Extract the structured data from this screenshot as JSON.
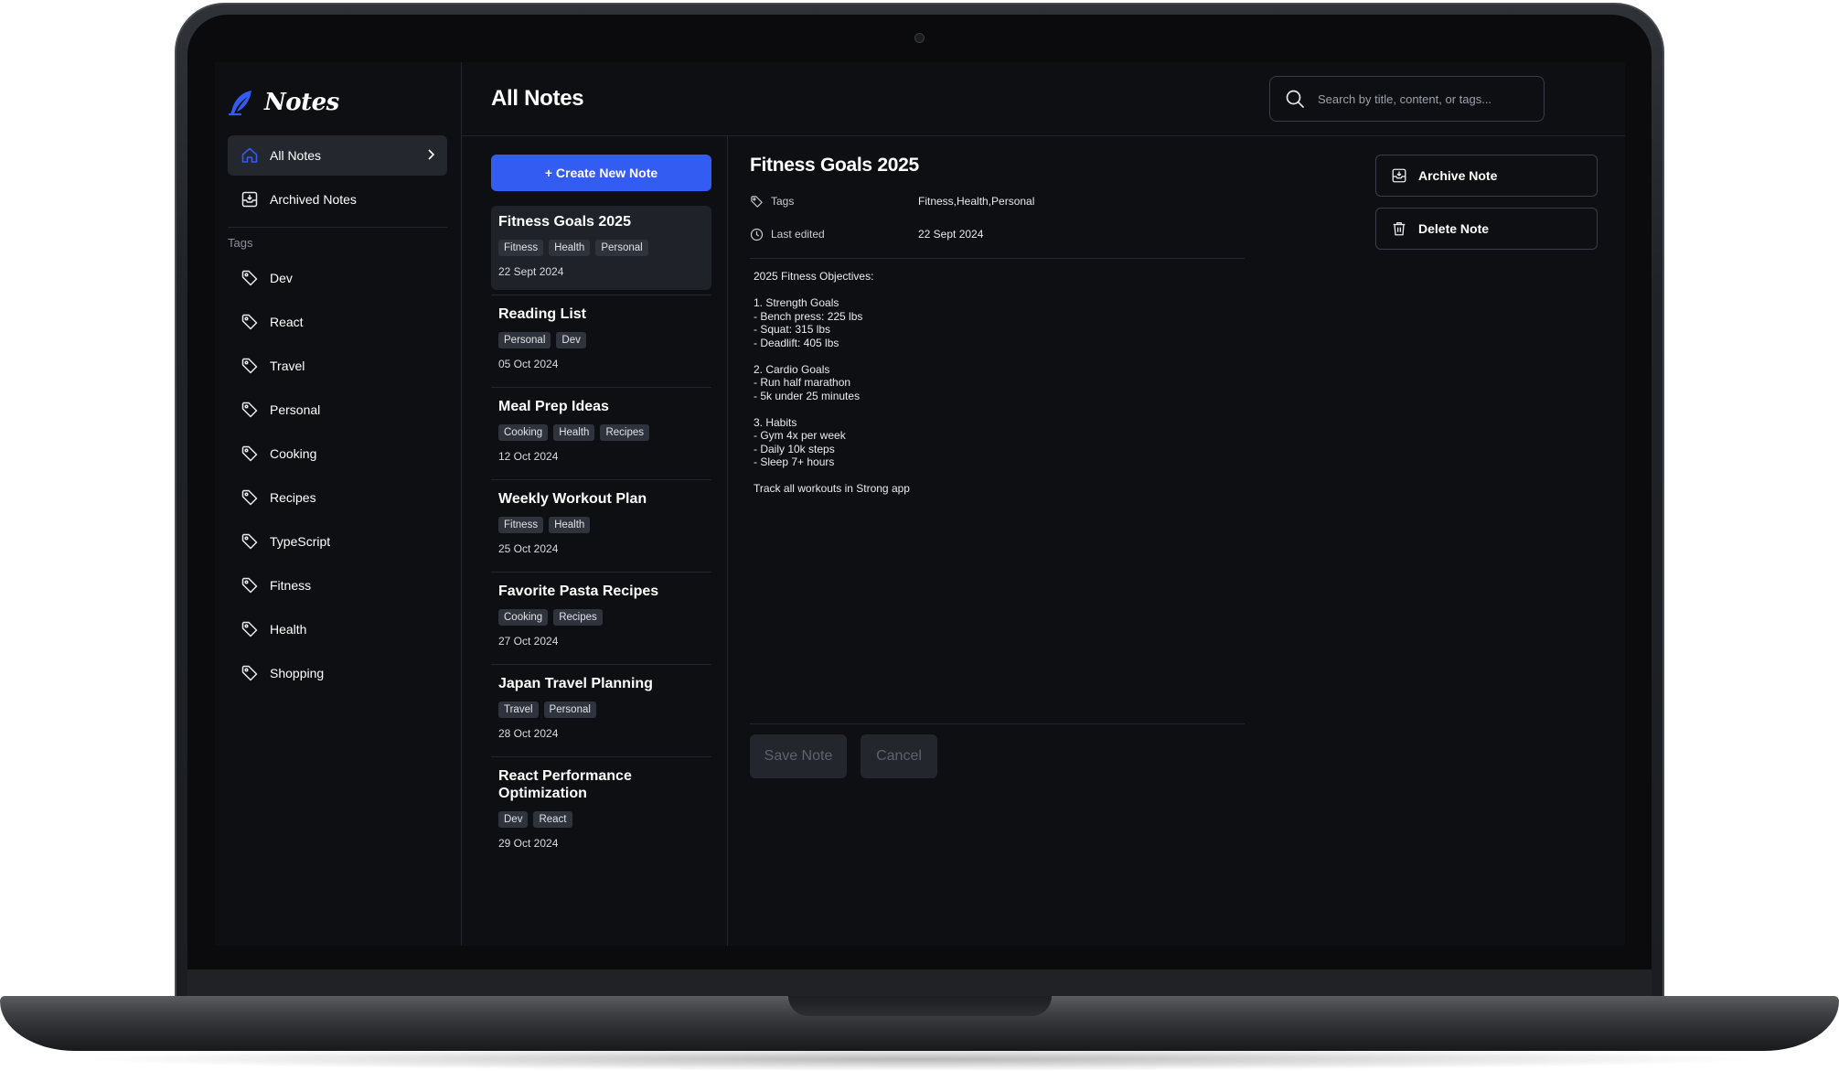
{
  "app": {
    "name": "Notes",
    "accent": "#335cf3"
  },
  "sidebar": {
    "nav": [
      {
        "label": "All Notes",
        "icon": "home-icon",
        "active": true
      },
      {
        "label": "Archived Notes",
        "icon": "archive-icon",
        "active": false
      }
    ],
    "tags_heading": "Tags",
    "tags": [
      "Dev",
      "React",
      "Travel",
      "Personal",
      "Cooking",
      "Recipes",
      "TypeScript",
      "Fitness",
      "Health",
      "Shopping"
    ]
  },
  "header": {
    "title": "All Notes",
    "search_placeholder": "Search by title, content, or tags..."
  },
  "list": {
    "create_label": "+ Create New Note",
    "notes": [
      {
        "title": "Fitness Goals 2025",
        "tags": [
          "Fitness",
          "Health",
          "Personal"
        ],
        "date": "22 Sept 2024",
        "selected": true
      },
      {
        "title": "Reading List",
        "tags": [
          "Personal",
          "Dev"
        ],
        "date": "05 Oct 2024"
      },
      {
        "title": "Meal Prep Ideas",
        "tags": [
          "Cooking",
          "Health",
          "Recipes"
        ],
        "date": "12 Oct 2024"
      },
      {
        "title": "Weekly Workout Plan",
        "tags": [
          "Fitness",
          "Health"
        ],
        "date": "25 Oct 2024"
      },
      {
        "title": "Favorite Pasta Recipes",
        "tags": [
          "Cooking",
          "Recipes"
        ],
        "date": "27 Oct 2024"
      },
      {
        "title": "Japan Travel Planning",
        "tags": [
          "Travel",
          "Personal"
        ],
        "date": "28 Oct 2024"
      },
      {
        "title": "React Performance Optimization",
        "tags": [
          "Dev",
          "React"
        ],
        "date": "29 Oct 2024"
      }
    ]
  },
  "detail": {
    "title": "Fitness Goals 2025",
    "tags_label": "Tags",
    "tags_value": "Fitness,Health,Personal",
    "edited_label": "Last edited",
    "edited_value": "22 Sept 2024",
    "content": "2025 Fitness Objectives:\n\n1. Strength Goals\n- Bench press: 225 lbs\n- Squat: 315 lbs\n- Deadlift: 405 lbs\n\n2. Cardio Goals\n- Run half marathon\n- 5k under 25 minutes\n\n3. Habits\n- Gym 4x per week\n- Daily 10k steps\n- Sleep 7+ hours\n\nTrack all workouts in Strong app",
    "save_label": "Save Note",
    "cancel_label": "Cancel"
  },
  "actions": {
    "archive_label": "Archive Note",
    "delete_label": "Delete Note"
  }
}
